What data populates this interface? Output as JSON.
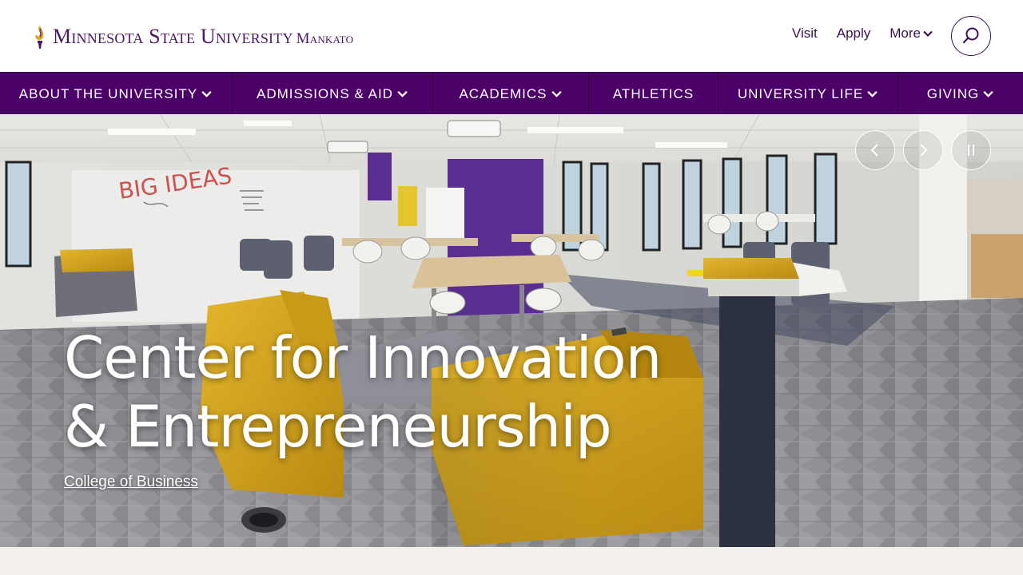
{
  "header": {
    "logo_main": "Minnesota State University",
    "logo_sub": "Mankato",
    "util_links": [
      "Visit",
      "Apply",
      "More"
    ],
    "search_label": "Search"
  },
  "mainnav": {
    "items": [
      {
        "label": "ABOUT THE UNIVERSITY",
        "has_menu": true
      },
      {
        "label": "ADMISSIONS & AID",
        "has_menu": true
      },
      {
        "label": "ACADEMICS",
        "has_menu": true
      },
      {
        "label": "ATHLETICS",
        "has_menu": false
      },
      {
        "label": "UNIVERSITY LIFE",
        "has_menu": true
      },
      {
        "label": "GIVING",
        "has_menu": true
      }
    ]
  },
  "hero": {
    "title": "Center for Innovation & Entrepreneurship",
    "link": "College of Business",
    "whiteboard_text": "BIG IDEAS",
    "controls": {
      "prev": "previous-slide",
      "next": "next-slide",
      "pause": "pause-slideshow"
    }
  },
  "colors": {
    "brand_purple": "#4b0068",
    "logo_purple": "#4b1664",
    "gold": "#d8a820"
  }
}
